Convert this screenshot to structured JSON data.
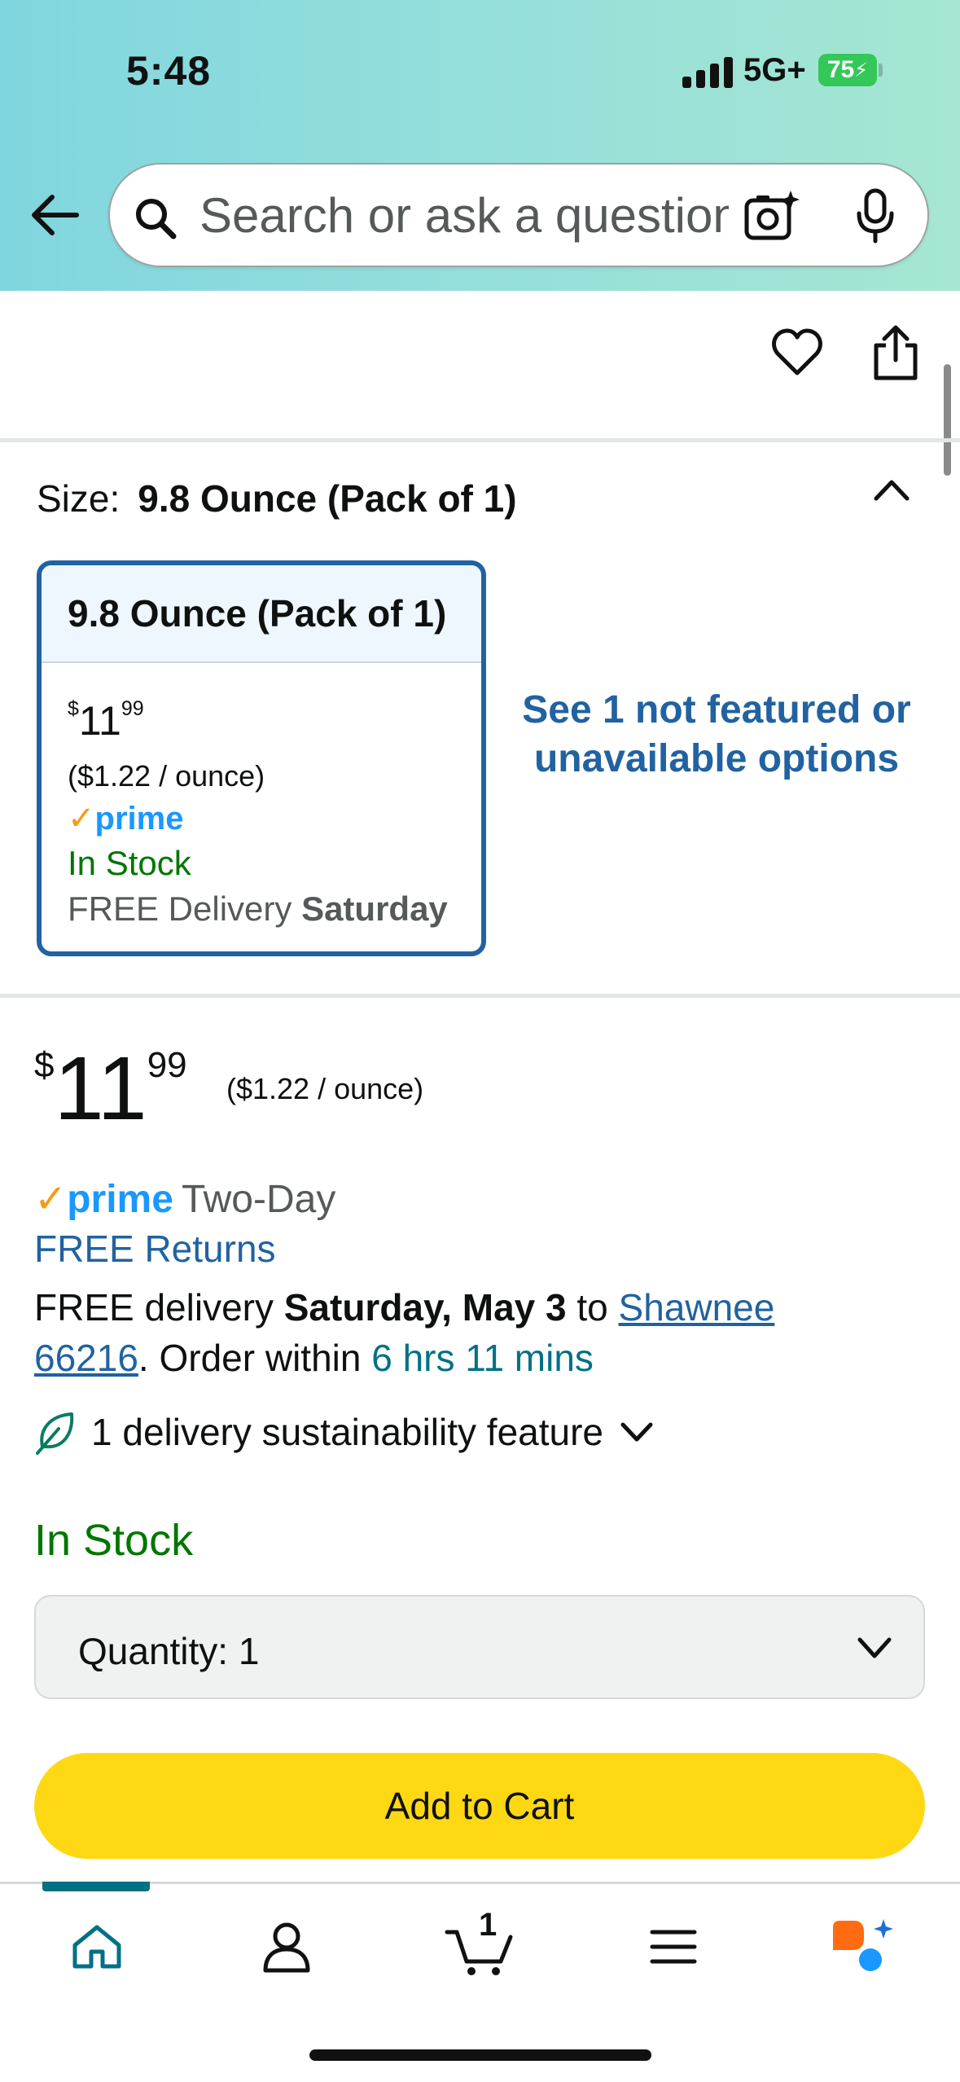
{
  "status_bar": {
    "time": "5:48",
    "network": "5G+",
    "battery": "75"
  },
  "search": {
    "placeholder": "Search or ask a question"
  },
  "size": {
    "label": "Size:",
    "selected": "9.8 Ounce (Pack of 1)"
  },
  "size_option": {
    "title": "9.8 Ounce (Pack of 1)",
    "price_currency": "$",
    "price_whole": "11",
    "price_fraction": "99",
    "unit_price": "($1.22 / ounce)",
    "prime": "prime",
    "stock": "In Stock",
    "delivery_prefix": "FREE Delivery",
    "delivery_day": "Saturday"
  },
  "not_featured_link": "See 1 not featured or unavailable options",
  "price": {
    "currency": "$",
    "whole": "11",
    "fraction": "99",
    "unit_price": "($1.22 / ounce)"
  },
  "prime_badge": {
    "check": "✓",
    "word": "prime",
    "suffix": "Two-Day"
  },
  "free_returns": "FREE Returns",
  "delivery": {
    "prefix": "FREE delivery",
    "date": "Saturday, May 3",
    "to": "to",
    "location_line1": "Shawnee",
    "location_line2": "66216",
    "order_within": ". Order within",
    "countdown": "6 hrs 11 mins"
  },
  "sustainability": "1 delivery sustainability feature",
  "stock_status": "In Stock",
  "quantity": {
    "label": "Quantity:",
    "value": "1"
  },
  "add_to_cart": "Add to Cart",
  "cart_count": "1",
  "colors": {
    "header_gradient_start": "#80d6de",
    "header_gradient_end": "#a6e6d2",
    "link_blue": "#2162a1",
    "stock_green": "#007600",
    "teal": "#007185",
    "cart_button": "#ffd814",
    "prime_blue": "#1a98ff",
    "prime_orange": "#f79b12"
  },
  "bottom_nav": [
    {
      "name": "home-tab",
      "icon": "home-icon",
      "active": true
    },
    {
      "name": "account-tab",
      "icon": "person-icon"
    },
    {
      "name": "cart-tab",
      "icon": "cart-icon"
    },
    {
      "name": "menu-tab",
      "icon": "hamburger-icon"
    },
    {
      "name": "rufus-tab",
      "icon": "ai-assistant-icon"
    }
  ]
}
